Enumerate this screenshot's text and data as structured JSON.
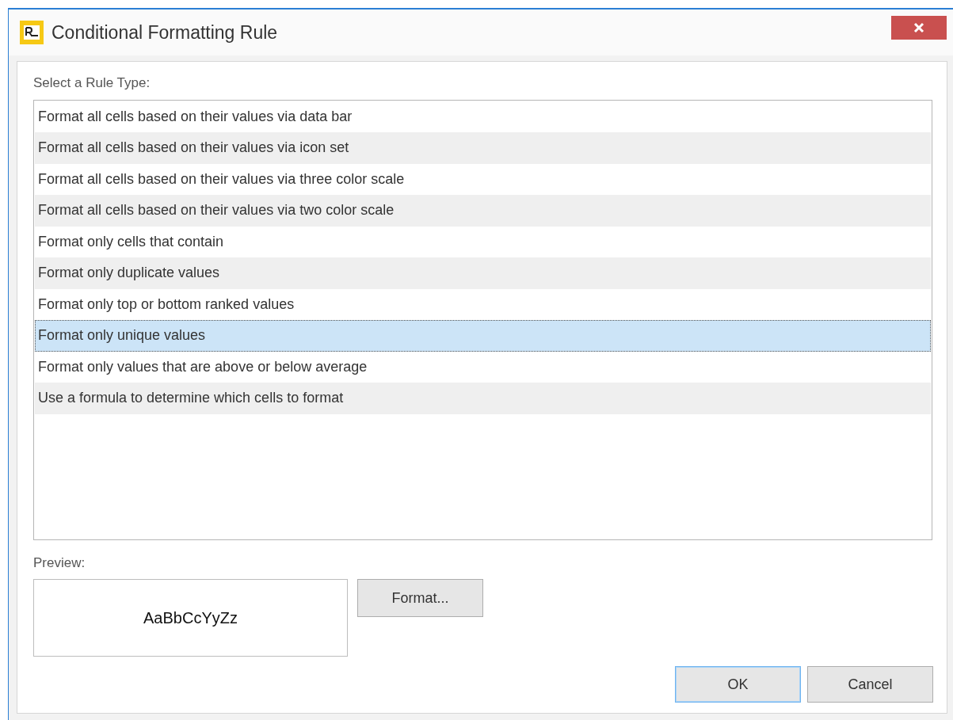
{
  "window": {
    "title": "Conditional Formatting Rule"
  },
  "rule_type_label": "Select a Rule Type:",
  "rules": [
    {
      "label": "Format all cells based on their values via data bar",
      "selected": false
    },
    {
      "label": "Format all cells based on their values via icon set",
      "selected": false
    },
    {
      "label": "Format all cells based on their values via three color scale",
      "selected": false
    },
    {
      "label": "Format all cells based on their values via two color scale",
      "selected": false
    },
    {
      "label": "Format only cells that contain",
      "selected": false
    },
    {
      "label": "Format only duplicate values",
      "selected": false
    },
    {
      "label": "Format only top or bottom ranked values",
      "selected": false
    },
    {
      "label": "Format only unique values",
      "selected": true
    },
    {
      "label": "Format only values that are above or below average",
      "selected": false
    },
    {
      "label": "Use a formula to determine which cells to format",
      "selected": false
    }
  ],
  "preview": {
    "label": "Preview:",
    "sample": "AaBbCcYyZz"
  },
  "format_button": "Format...",
  "buttons": [
    {
      "label": "OK",
      "default": true
    },
    {
      "label": "Cancel",
      "default": false
    }
  ]
}
